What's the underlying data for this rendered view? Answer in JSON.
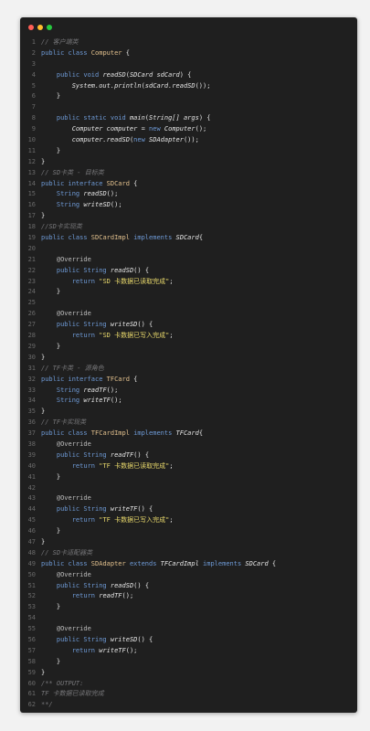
{
  "window": {
    "controls": {
      "close": "close",
      "minimize": "minimize",
      "maximize": "maximize"
    }
  },
  "code_lines": [
    {
      "n": "1",
      "tokens": [
        {
          "c": "c",
          "t": "// 客户端类"
        }
      ]
    },
    {
      "n": "2",
      "tokens": [
        {
          "c": "k",
          "t": "public class "
        },
        {
          "c": "t",
          "t": "Computer"
        },
        {
          "c": "txt",
          "t": " {"
        }
      ]
    },
    {
      "n": "3",
      "tokens": []
    },
    {
      "n": "4",
      "tokens": [
        {
          "c": "txt",
          "t": "    "
        },
        {
          "c": "k",
          "t": "public void "
        },
        {
          "c": "i",
          "t": "readSD"
        },
        {
          "c": "txt",
          "t": "("
        },
        {
          "c": "i",
          "t": "SDCard sdCard"
        },
        {
          "c": "txt",
          "t": ") {"
        }
      ]
    },
    {
      "n": "5",
      "tokens": [
        {
          "c": "txt",
          "t": "        "
        },
        {
          "c": "i",
          "t": "System.out.println"
        },
        {
          "c": "txt",
          "t": "("
        },
        {
          "c": "i",
          "t": "sdCard.readSD"
        },
        {
          "c": "txt",
          "t": "());"
        }
      ]
    },
    {
      "n": "6",
      "tokens": [
        {
          "c": "txt",
          "t": "    }"
        }
      ]
    },
    {
      "n": "7",
      "tokens": []
    },
    {
      "n": "8",
      "tokens": [
        {
          "c": "txt",
          "t": "    "
        },
        {
          "c": "k",
          "t": "public static void "
        },
        {
          "c": "i",
          "t": "main"
        },
        {
          "c": "txt",
          "t": "("
        },
        {
          "c": "i",
          "t": "String[] args"
        },
        {
          "c": "txt",
          "t": ") {"
        }
      ]
    },
    {
      "n": "9",
      "tokens": [
        {
          "c": "txt",
          "t": "        "
        },
        {
          "c": "i",
          "t": "Computer computer"
        },
        {
          "c": "txt",
          "t": " = "
        },
        {
          "c": "k",
          "t": "new "
        },
        {
          "c": "i",
          "t": "Computer"
        },
        {
          "c": "txt",
          "t": "();"
        }
      ]
    },
    {
      "n": "10",
      "tokens": [
        {
          "c": "txt",
          "t": "        "
        },
        {
          "c": "i",
          "t": "computer.readSD"
        },
        {
          "c": "txt",
          "t": "("
        },
        {
          "c": "k",
          "t": "new "
        },
        {
          "c": "i",
          "t": "SDAdapter"
        },
        {
          "c": "txt",
          "t": "());"
        }
      ]
    },
    {
      "n": "11",
      "tokens": [
        {
          "c": "txt",
          "t": "    }"
        }
      ]
    },
    {
      "n": "12",
      "tokens": [
        {
          "c": "txt",
          "t": "}"
        }
      ]
    },
    {
      "n": "13",
      "tokens": [
        {
          "c": "c",
          "t": "// SD卡类 - 目标类"
        }
      ]
    },
    {
      "n": "14",
      "tokens": [
        {
          "c": "k",
          "t": "public interface "
        },
        {
          "c": "t",
          "t": "SDCard"
        },
        {
          "c": "txt",
          "t": " {"
        }
      ]
    },
    {
      "n": "15",
      "tokens": [
        {
          "c": "txt",
          "t": "    "
        },
        {
          "c": "k",
          "t": "String "
        },
        {
          "c": "i",
          "t": "readSD"
        },
        {
          "c": "txt",
          "t": "();"
        }
      ]
    },
    {
      "n": "16",
      "tokens": [
        {
          "c": "txt",
          "t": "    "
        },
        {
          "c": "k",
          "t": "String "
        },
        {
          "c": "i",
          "t": "writeSD"
        },
        {
          "c": "txt",
          "t": "();"
        }
      ]
    },
    {
      "n": "17",
      "tokens": [
        {
          "c": "txt",
          "t": "}"
        }
      ]
    },
    {
      "n": "18",
      "tokens": [
        {
          "c": "c",
          "t": "//SD卡实现类"
        }
      ]
    },
    {
      "n": "19",
      "tokens": [
        {
          "c": "k",
          "t": "public class "
        },
        {
          "c": "t",
          "t": "SDCardImpl"
        },
        {
          "c": "k",
          "t": " implements "
        },
        {
          "c": "i",
          "t": "SDCard"
        },
        {
          "c": "txt",
          "t": "{"
        }
      ]
    },
    {
      "n": "20",
      "tokens": []
    },
    {
      "n": "21",
      "tokens": [
        {
          "c": "txt",
          "t": "    "
        },
        {
          "c": "a",
          "t": "@Override"
        }
      ]
    },
    {
      "n": "22",
      "tokens": [
        {
          "c": "txt",
          "t": "    "
        },
        {
          "c": "k",
          "t": "public String "
        },
        {
          "c": "i",
          "t": "readSD"
        },
        {
          "c": "txt",
          "t": "() {"
        }
      ]
    },
    {
      "n": "23",
      "tokens": [
        {
          "c": "txt",
          "t": "        "
        },
        {
          "c": "k",
          "t": "return "
        },
        {
          "c": "s",
          "t": "\"SD 卡数据已读取完成\""
        },
        {
          "c": "txt",
          "t": ";"
        }
      ]
    },
    {
      "n": "24",
      "tokens": [
        {
          "c": "txt",
          "t": "    }"
        }
      ]
    },
    {
      "n": "25",
      "tokens": []
    },
    {
      "n": "26",
      "tokens": [
        {
          "c": "txt",
          "t": "    "
        },
        {
          "c": "a",
          "t": "@Override"
        }
      ]
    },
    {
      "n": "27",
      "tokens": [
        {
          "c": "txt",
          "t": "    "
        },
        {
          "c": "k",
          "t": "public String "
        },
        {
          "c": "i",
          "t": "writeSD"
        },
        {
          "c": "txt",
          "t": "() {"
        }
      ]
    },
    {
      "n": "28",
      "tokens": [
        {
          "c": "txt",
          "t": "        "
        },
        {
          "c": "k",
          "t": "return "
        },
        {
          "c": "s",
          "t": "\"SD 卡数据已写入完成\""
        },
        {
          "c": "txt",
          "t": ";"
        }
      ]
    },
    {
      "n": "29",
      "tokens": [
        {
          "c": "txt",
          "t": "    }"
        }
      ]
    },
    {
      "n": "30",
      "tokens": [
        {
          "c": "txt",
          "t": "}"
        }
      ]
    },
    {
      "n": "31",
      "tokens": [
        {
          "c": "c",
          "t": "// TF卡类 - 源角色"
        }
      ]
    },
    {
      "n": "32",
      "tokens": [
        {
          "c": "k",
          "t": "public interface "
        },
        {
          "c": "t",
          "t": "TFCard"
        },
        {
          "c": "txt",
          "t": " {"
        }
      ]
    },
    {
      "n": "33",
      "tokens": [
        {
          "c": "txt",
          "t": "    "
        },
        {
          "c": "k",
          "t": "String "
        },
        {
          "c": "i",
          "t": "readTF"
        },
        {
          "c": "txt",
          "t": "();"
        }
      ]
    },
    {
      "n": "34",
      "tokens": [
        {
          "c": "txt",
          "t": "    "
        },
        {
          "c": "k",
          "t": "String "
        },
        {
          "c": "i",
          "t": "writeTF"
        },
        {
          "c": "txt",
          "t": "();"
        }
      ]
    },
    {
      "n": "35",
      "tokens": [
        {
          "c": "txt",
          "t": "}"
        }
      ]
    },
    {
      "n": "36",
      "tokens": [
        {
          "c": "c",
          "t": "// TF卡实现类"
        }
      ]
    },
    {
      "n": "37",
      "tokens": [
        {
          "c": "k",
          "t": "public class "
        },
        {
          "c": "t",
          "t": "TFCardImpl"
        },
        {
          "c": "k",
          "t": " implements "
        },
        {
          "c": "i",
          "t": "TFCard"
        },
        {
          "c": "txt",
          "t": "{"
        }
      ]
    },
    {
      "n": "38",
      "tokens": [
        {
          "c": "txt",
          "t": "    "
        },
        {
          "c": "a",
          "t": "@Override"
        }
      ]
    },
    {
      "n": "39",
      "tokens": [
        {
          "c": "txt",
          "t": "    "
        },
        {
          "c": "k",
          "t": "public String "
        },
        {
          "c": "i",
          "t": "readTF"
        },
        {
          "c": "txt",
          "t": "() {"
        }
      ]
    },
    {
      "n": "40",
      "tokens": [
        {
          "c": "txt",
          "t": "        "
        },
        {
          "c": "k",
          "t": "return "
        },
        {
          "c": "s",
          "t": "\"TF 卡数据已读取完成\""
        },
        {
          "c": "txt",
          "t": ";"
        }
      ]
    },
    {
      "n": "41",
      "tokens": [
        {
          "c": "txt",
          "t": "    }"
        }
      ]
    },
    {
      "n": "42",
      "tokens": []
    },
    {
      "n": "43",
      "tokens": [
        {
          "c": "txt",
          "t": "    "
        },
        {
          "c": "a",
          "t": "@Override"
        }
      ]
    },
    {
      "n": "44",
      "tokens": [
        {
          "c": "txt",
          "t": "    "
        },
        {
          "c": "k",
          "t": "public String "
        },
        {
          "c": "i",
          "t": "writeTF"
        },
        {
          "c": "txt",
          "t": "() {"
        }
      ]
    },
    {
      "n": "45",
      "tokens": [
        {
          "c": "txt",
          "t": "        "
        },
        {
          "c": "k",
          "t": "return "
        },
        {
          "c": "s",
          "t": "\"TF 卡数据已写入完成\""
        },
        {
          "c": "txt",
          "t": ";"
        }
      ]
    },
    {
      "n": "46",
      "tokens": [
        {
          "c": "txt",
          "t": "    }"
        }
      ]
    },
    {
      "n": "47",
      "tokens": [
        {
          "c": "txt",
          "t": "}"
        }
      ]
    },
    {
      "n": "48",
      "tokens": [
        {
          "c": "c",
          "t": "// SD卡适配器类"
        }
      ]
    },
    {
      "n": "49",
      "tokens": [
        {
          "c": "k",
          "t": "public class "
        },
        {
          "c": "t",
          "t": "SDAdapter"
        },
        {
          "c": "k",
          "t": " extends "
        },
        {
          "c": "i",
          "t": "TFCardImpl"
        },
        {
          "c": "k",
          "t": " implements "
        },
        {
          "c": "i",
          "t": "SDCard"
        },
        {
          "c": "txt",
          "t": " {"
        }
      ]
    },
    {
      "n": "50",
      "tokens": [
        {
          "c": "txt",
          "t": "    "
        },
        {
          "c": "a",
          "t": "@Override"
        }
      ]
    },
    {
      "n": "51",
      "tokens": [
        {
          "c": "txt",
          "t": "    "
        },
        {
          "c": "k",
          "t": "public String "
        },
        {
          "c": "i",
          "t": "readSD"
        },
        {
          "c": "txt",
          "t": "() {"
        }
      ]
    },
    {
      "n": "52",
      "tokens": [
        {
          "c": "txt",
          "t": "        "
        },
        {
          "c": "k",
          "t": "return "
        },
        {
          "c": "i",
          "t": "readTF"
        },
        {
          "c": "txt",
          "t": "();"
        }
      ]
    },
    {
      "n": "53",
      "tokens": [
        {
          "c": "txt",
          "t": "    }"
        }
      ]
    },
    {
      "n": "54",
      "tokens": []
    },
    {
      "n": "55",
      "tokens": [
        {
          "c": "txt",
          "t": "    "
        },
        {
          "c": "a",
          "t": "@Override"
        }
      ]
    },
    {
      "n": "56",
      "tokens": [
        {
          "c": "txt",
          "t": "    "
        },
        {
          "c": "k",
          "t": "public String "
        },
        {
          "c": "i",
          "t": "writeSD"
        },
        {
          "c": "txt",
          "t": "() {"
        }
      ]
    },
    {
      "n": "57",
      "tokens": [
        {
          "c": "txt",
          "t": "        "
        },
        {
          "c": "k",
          "t": "return "
        },
        {
          "c": "i",
          "t": "writeTF"
        },
        {
          "c": "txt",
          "t": "();"
        }
      ]
    },
    {
      "n": "58",
      "tokens": [
        {
          "c": "txt",
          "t": "    }"
        }
      ]
    },
    {
      "n": "59",
      "tokens": [
        {
          "c": "txt",
          "t": "}"
        }
      ]
    },
    {
      "n": "60",
      "tokens": [
        {
          "c": "c",
          "t": "/** OUTPUT:"
        }
      ]
    },
    {
      "n": "61",
      "tokens": [
        {
          "c": "c",
          "t": "TF 卡数据已读取完成"
        }
      ]
    },
    {
      "n": "62",
      "tokens": [
        {
          "c": "c",
          "t": "**/"
        }
      ]
    }
  ]
}
